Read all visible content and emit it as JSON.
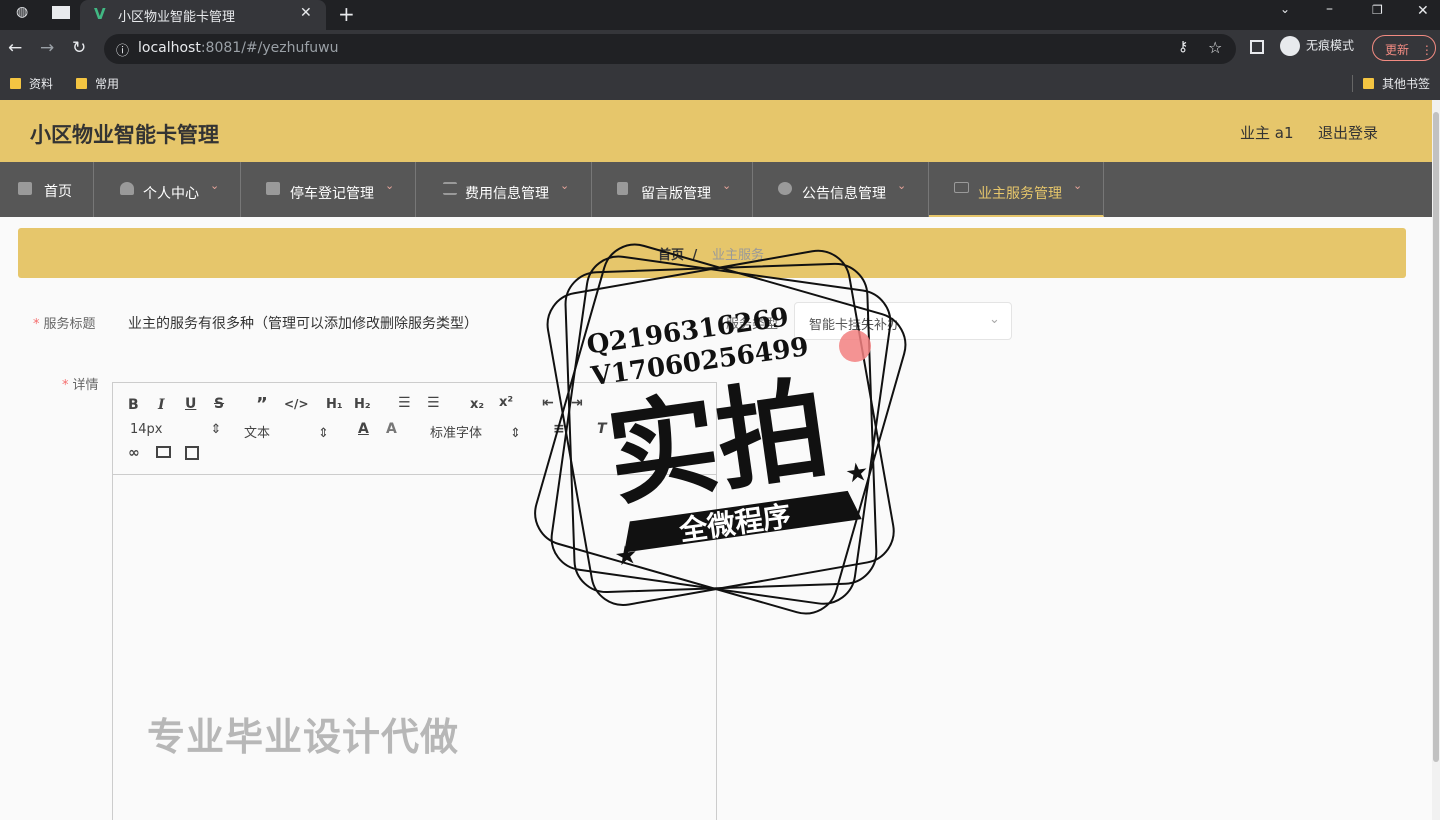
{
  "browser": {
    "tab_title": "小区物业智能卡管理",
    "url_host": "localhost",
    "url_rest": ":8081/#/yezhufuwu",
    "incognito_label": "无痕模式",
    "update_label": "更新",
    "bookmarks": [
      "资料",
      "常用"
    ],
    "other_bookmarks": "其他书签"
  },
  "app": {
    "title": "小区物业智能卡管理",
    "user_label": "业主 a1",
    "logout_label": "退出登录"
  },
  "menu": [
    {
      "label": "首页",
      "icon": "home-icon"
    },
    {
      "label": "个人中心",
      "icon": "user-icon"
    },
    {
      "label": "停车登记管理",
      "icon": "briefcase-icon"
    },
    {
      "label": "费用信息管理",
      "icon": "list-icon"
    },
    {
      "label": "留言版管理",
      "icon": "clipboard-icon"
    },
    {
      "label": "公告信息管理",
      "icon": "compass-icon"
    },
    {
      "label": "业主服务管理",
      "icon": "mail-icon"
    }
  ],
  "breadcrumb": {
    "home": "首页",
    "sep": "/",
    "current": "业主服务"
  },
  "form": {
    "title_label": "服务标题",
    "title_value": "业主的服务有很多种（管理可以添加修改删除服务类型）",
    "type_label": "服务类型",
    "type_value": "智能卡挂失补办",
    "detail_label": "详情"
  },
  "editor": {
    "font_size": "14px",
    "text_style": "文本",
    "font_family": "标准字体"
  },
  "watermark": {
    "contact1": "Q2196316269",
    "contact2": "V17060256499",
    "main": "实拍",
    "sub": "全微程序",
    "bottom": "专业毕业设计代做"
  },
  "colors": {
    "header": "#e6c66b",
    "menu": "#575757",
    "accent": "#e6c66b"
  }
}
